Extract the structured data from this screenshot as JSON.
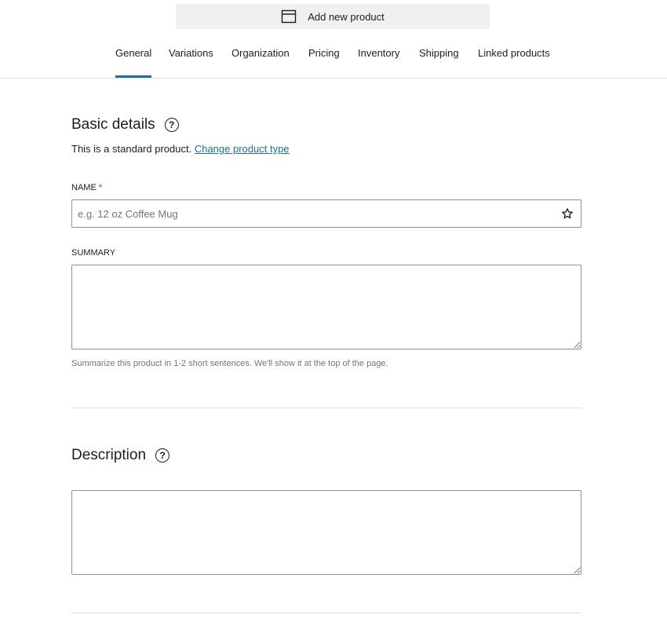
{
  "header": {
    "title": "Add new product",
    "icon": "archive-box-icon"
  },
  "tabs": [
    {
      "label": "General",
      "active": true
    },
    {
      "label": "Variations",
      "active": false
    },
    {
      "label": "Organization",
      "active": false
    },
    {
      "label": "Pricing",
      "active": false
    },
    {
      "label": "Inventory",
      "active": false
    },
    {
      "label": "Shipping",
      "active": false
    },
    {
      "label": "Linked products",
      "active": false
    }
  ],
  "basic_details": {
    "title": "Basic details",
    "help_symbol": "?",
    "product_type_text": "This is a standard product.",
    "change_type_link": "Change product type",
    "name_label": "Name",
    "required_marker": "*",
    "name_placeholder": "e.g. 12 oz Coffee Mug",
    "name_value": "",
    "summary_label": "Summary",
    "summary_value": "",
    "summary_help": "Summarize this product in 1-2 short sentences. We'll show it at the top of the page."
  },
  "description": {
    "title": "Description",
    "help_symbol": "?",
    "value": ""
  },
  "colors": {
    "accent": "#1d6fa5",
    "required": "#cc1818",
    "muted_text": "#757575",
    "border": "#8c8f94",
    "divider": "#e0e0e0",
    "topbar_bg": "#f0f0f0"
  }
}
